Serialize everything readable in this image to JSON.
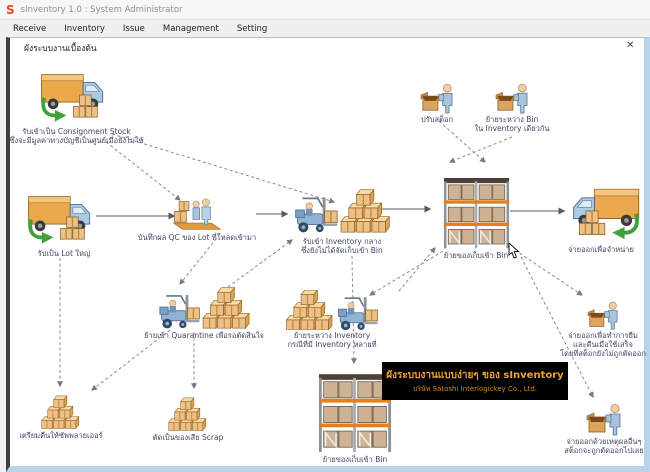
{
  "window": {
    "logo": "S",
    "title": "sInventory 1.0 : System Administrator",
    "panel_title": "ผังระบบงานเบื้องต้น",
    "close_glyph": "✕"
  },
  "menubar": {
    "items": [
      "Receive",
      "Inventory",
      "Issue",
      "Management",
      "Setting"
    ]
  },
  "diagram": {
    "nodes": {
      "consignment": {
        "line1": "รับเข้าเป็น Consignment Stock",
        "line2": "ซึ่งจะมีมูลค่าทางบัญชีเป็นศูนย์เมื่อยังไม่ใช้"
      },
      "receive_lot": {
        "line1": "รับเป็น Lot ใหญ่"
      },
      "qc": {
        "line1": "บันทึกผล QC ของ Lot ที่โหลดเข้ามา"
      },
      "receive_inventory": {
        "line1": "รับเข้า Inventory กลาง",
        "line2": "ซึ่งยังไม่ได้จัดเก็บเข้า Bin"
      },
      "store_bin": {
        "line1": "ย้ายของเก็บเข้า Bin"
      },
      "adjust_stock": {
        "line1": "ปรับสต็อก"
      },
      "move_between_bin": {
        "line1": "ย้ายระหว่าง Bin",
        "line2": "ใน Inventory เดียวกัน"
      },
      "issue_sale": {
        "line1": "จ่ายออกเพื่อจำหน่าย"
      },
      "quarantine": {
        "line1": "ย้ายเข้า Quarantine เพื่อรอตัดสินใจ"
      },
      "move_between_inventory": {
        "line1": "ย้ายระหว่าง Inventory",
        "line2": "กรณีที่มี Inventory หลายที่"
      },
      "return_supplier": {
        "line1": "เตรียมคืนให้ซัพพลายเออร์"
      },
      "scrap": {
        "line1": "ตัดเป็นของเสีย Scrap"
      },
      "store_bin2": {
        "line1": "ย้ายของเก็บเข้า Bin"
      },
      "borrow": {
        "line1": "จ่ายออกเพื่อทำการยืม",
        "line2": "และคืนเมื่อใช้เสร็จ",
        "line3": "โดยที่สต็อกยังไม่ถูกตัดออก"
      },
      "issue_other": {
        "line1": "จ่ายออกด้วยเหตุผลอื่นๆ",
        "line2": "สต็อกจะถูกตัดออกไปเลย"
      }
    },
    "caption": {
      "line1": "ผังระบบงานแบบง่ายๆ ของ sInventory",
      "line2": "บริษัท Satoshi Interlogickey Co., Ltd."
    }
  },
  "colors": {
    "logo": "#E8491D",
    "caption_bg": "#000000",
    "caption_text": "#F0A231",
    "green_arrow": "#3FA23A",
    "rack_beam": "#E2801E",
    "panel_border_dark": "#3F3F3F",
    "panel_border_blue": "#B9D3EA",
    "label_text": "#3F4566"
  }
}
